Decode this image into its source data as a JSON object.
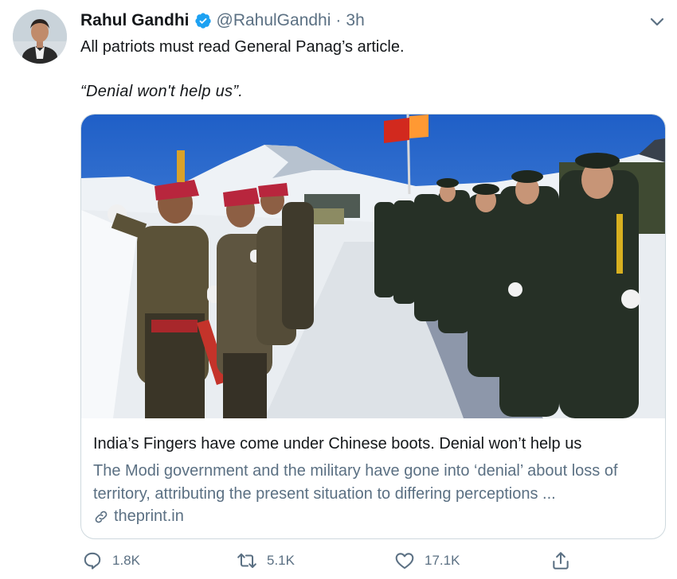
{
  "tweet": {
    "author_name": "Rahul Gandhi",
    "author_handle": "@RahulGandhi",
    "separator": "·",
    "time": "3h",
    "text_line1": "All patriots must read General Panag’s article.",
    "text_line2": "“Denial won't help us”."
  },
  "card": {
    "title": "India’s Fingers have come under Chinese boots. Denial won’t help us",
    "description": "The Modi government and the military have gone into ‘denial’ about loss of territory, attributing the present situation to differing perceptions ...",
    "domain": "theprint.in"
  },
  "actions": {
    "reply_count": "1.8K",
    "retweet_count": "5.1K",
    "like_count": "17.1K"
  },
  "colors": {
    "verified": "#1da1f2",
    "secondary_text": "#5b7083",
    "border": "#cfd9de"
  },
  "icons": [
    "verified-badge-icon",
    "chevron-down-icon",
    "link-icon",
    "reply-icon",
    "retweet-icon",
    "like-icon",
    "share-icon"
  ]
}
